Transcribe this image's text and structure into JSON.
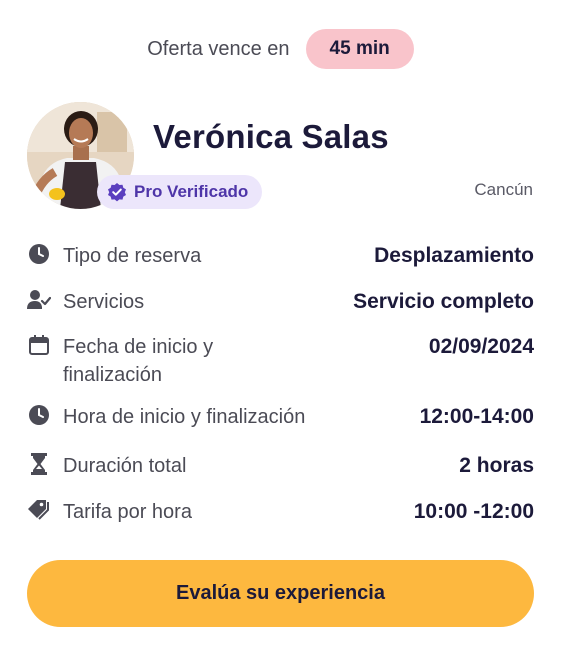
{
  "offer": {
    "label": "Oferta vence en",
    "time": "45 min"
  },
  "profile": {
    "name": "Verónica Salas",
    "badge": "Pro Verificado",
    "city": "Cancún"
  },
  "details": [
    {
      "icon": "clock-icon",
      "label": "Tipo de reserva",
      "value": "Desplazamiento"
    },
    {
      "icon": "user-check-icon",
      "label": "Servicios",
      "value": "Servicio completo"
    },
    {
      "icon": "calendar-icon",
      "label": "Fecha de inicio y finalización",
      "value": "02/09/2024"
    },
    {
      "icon": "clock-icon",
      "label": "Hora de inicio y finalización",
      "value": "12:00-14:00"
    },
    {
      "icon": "hourglass-icon",
      "label": "Duración total",
      "value": "2 horas"
    },
    {
      "icon": "tags-icon",
      "label": "Tarifa por hora",
      "value": "10:00 -12:00"
    }
  ],
  "cta": {
    "label": "Evalúa su experiencia"
  },
  "colors": {
    "badge_bg": "#f9c4cb",
    "verified_bg": "#ece6fb",
    "verified_text": "#4e35a8",
    "cta_bg": "#fdb83f",
    "text_dark": "#1c1a3a"
  }
}
